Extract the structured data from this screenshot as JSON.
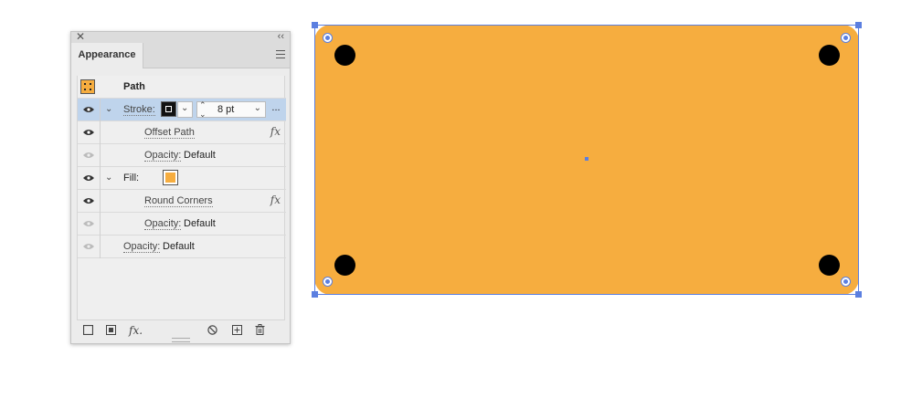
{
  "panel": {
    "tab_label": "Appearance",
    "rows": {
      "path_label": "Path",
      "stroke_label": "Stroke:",
      "stroke_weight": "8 pt",
      "more": "...",
      "offset_path": "Offset Path",
      "stroke_opacity_label": "Opacity:",
      "stroke_opacity_value": "Default",
      "fill_label": "Fill:",
      "round_corners": "Round Corners",
      "fill_opacity_label": "Opacity:",
      "fill_opacity_value": "Default",
      "opacity_label": "Opacity:",
      "opacity_value": "Default"
    },
    "icons": {
      "fx": "fx",
      "bottom_fx": "fx."
    }
  },
  "colors": {
    "fill": "#f6ad3f",
    "selection": "#5b7fe0",
    "dots": "#000000"
  }
}
